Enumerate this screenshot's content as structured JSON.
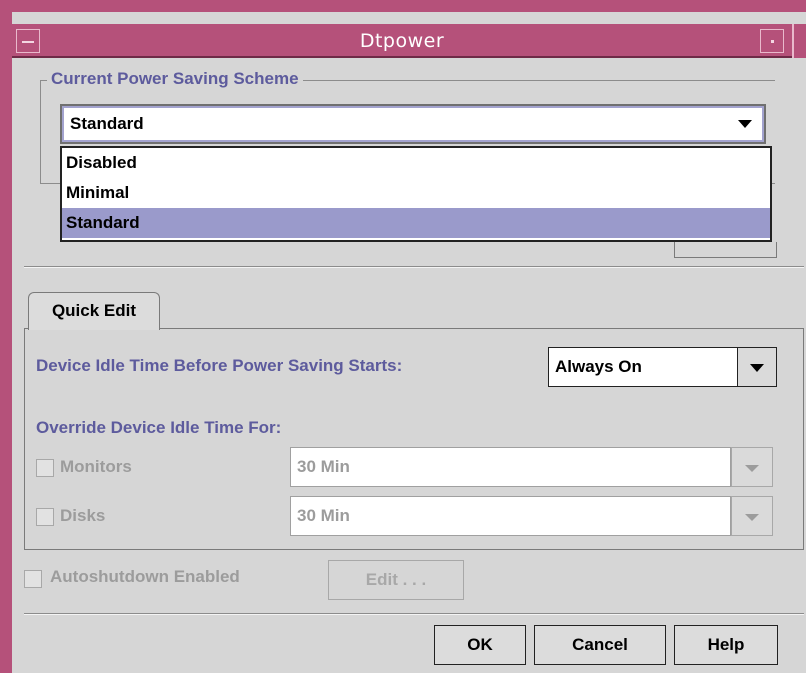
{
  "window": {
    "title": "Dtpower"
  },
  "scheme_group": {
    "legend": "Current Power Saving Scheme",
    "selected": "Standard",
    "options": [
      "Disabled",
      "Minimal",
      "Standard"
    ],
    "selected_index": 2
  },
  "tabs": [
    {
      "label": "Quick Edit"
    }
  ],
  "quick_edit": {
    "idle_label": "Device Idle Time Before Power Saving Starts:",
    "idle_value": "Always On",
    "override_label": "Override Device Idle Time For:",
    "monitors": {
      "label": "Monitors",
      "value": "30 Min",
      "checked": false
    },
    "disks": {
      "label": "Disks",
      "value": "30 Min",
      "checked": false
    }
  },
  "autoshutdown": {
    "label": "Autoshutdown Enabled",
    "checked": false,
    "edit_label": "Edit . . ."
  },
  "buttons": {
    "ok": "OK",
    "cancel": "Cancel",
    "help": "Help"
  },
  "colors": {
    "titlebar": "#b5517a",
    "label_purple": "#5d5b9d",
    "selection": "#9a9acb",
    "background": "#d6d6d6"
  },
  "icons": {
    "window_menu": "window-menu-icon",
    "minimize": "minimize-icon",
    "dropdown_arrow": "triangle-down-icon"
  }
}
